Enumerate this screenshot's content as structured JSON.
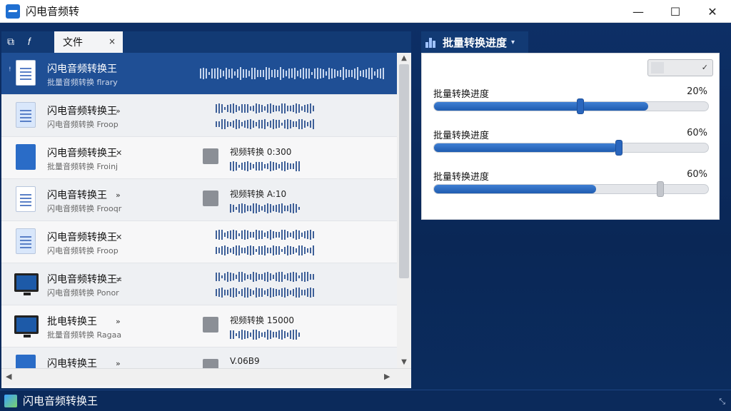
{
  "window": {
    "title": "闪电音频转",
    "controls": {
      "minimize": "—",
      "maximize": "☐",
      "close": "✕"
    }
  },
  "tabs": {
    "icon1": "⧉",
    "icon2": "𝑓",
    "file_tab": "文件",
    "close": "×"
  },
  "file_list": [
    {
      "title": "闪电音频转换王",
      "subtitle": "批量音频转换 flrary",
      "selected": true,
      "marker": "ꜝ",
      "arrow": "",
      "info": "",
      "icon": "doc"
    },
    {
      "title": "闪电音频转换王",
      "subtitle": "闪电音频转换 Froop",
      "selected": false,
      "arrow": "»",
      "info": "",
      "icon": "doc-blue"
    },
    {
      "title": "闪电音频转换王",
      "subtitle": "批量音频转换 Froinj",
      "selected": false,
      "arrow": "✕",
      "info": "视频转换 0:300",
      "icon": "app"
    },
    {
      "title": "闪电音转换王",
      "subtitle": "闪电音频转换 Frooqr",
      "selected": false,
      "arrow": "»",
      "info": "视频转换 A:10",
      "icon": "doc"
    },
    {
      "title": "闪电音频转换王",
      "subtitle": "闪电音频转换 Froop",
      "selected": false,
      "arrow": "✕",
      "info": "",
      "icon": "doc-blue"
    },
    {
      "title": "闪电音频转换王",
      "subtitle": "闪电音频转换 Ponor",
      "selected": false,
      "arrow": "≭",
      "info": "",
      "icon": "monitor"
    },
    {
      "title": "批电转换王",
      "subtitle": "批量音频转换 Ragaa",
      "selected": false,
      "arrow": "»",
      "info": "视频转换 15000",
      "icon": "monitor"
    },
    {
      "title": "闪电转换王",
      "subtitle": "",
      "selected": false,
      "arrow": "»",
      "info": "V.06B9",
      "icon": "app"
    }
  ],
  "scroll": {
    "up": "▲",
    "down": "▼",
    "left": "◀",
    "right": "▶"
  },
  "panel": {
    "title": "批量转换进度",
    "caret": "▾",
    "dropdown_caret": "✓",
    "progress": [
      {
        "label": "批量转换进度",
        "percent_text": "20%",
        "fill": 0.78,
        "thumb": 0.53
      },
      {
        "label": "批量转换进度",
        "percent_text": "60%",
        "fill": 0.67,
        "thumb": 0.67
      },
      {
        "label": "批量转换进度",
        "percent_text": "60%",
        "fill": 0.59,
        "thumb": 0.82
      }
    ]
  },
  "statusbar": {
    "title": "闪电音频转换王",
    "grip": "⤡"
  },
  "colors": {
    "accent": "#1f5cb0",
    "selected_row": "#1f4f95",
    "background": "#0b2a5b"
  }
}
